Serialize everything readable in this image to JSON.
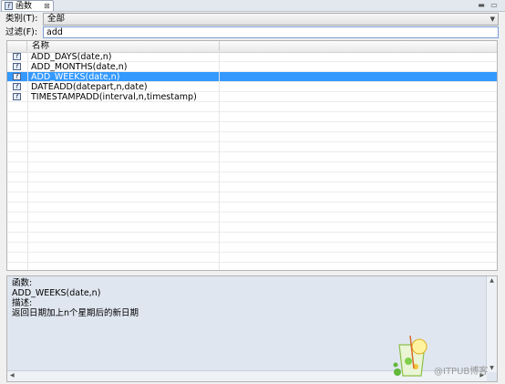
{
  "tab": {
    "title": "函数",
    "close_glyph": "⊠"
  },
  "window": {
    "minimize": "▬",
    "maximize": "▭"
  },
  "category": {
    "label": "类别(T):",
    "value": "全部"
  },
  "filter": {
    "label": "过滤(F):",
    "value": "add"
  },
  "table": {
    "columns": [
      "名称"
    ],
    "rows": [
      {
        "name": "ADD_DAYS(date,n)",
        "selected": false
      },
      {
        "name": "ADD_MONTHS(date,n)",
        "selected": false
      },
      {
        "name": "ADD_WEEKS(date,n)",
        "selected": true
      },
      {
        "name": "DATEADD(datepart,n,date)",
        "selected": false
      },
      {
        "name": "TIMESTAMPADD(interval,n,timestamp)",
        "selected": false
      }
    ]
  },
  "description": {
    "func_label": "函数:",
    "func_value": "ADD_WEEKS(date,n)",
    "desc_label": "描述:",
    "desc_value": "返回日期加上n个星期后的新日期"
  },
  "watermark": {
    "text": "@ITPUB博客"
  },
  "colors": {
    "selection": "#3399ff",
    "desc_bg": "#dfe6ef"
  }
}
